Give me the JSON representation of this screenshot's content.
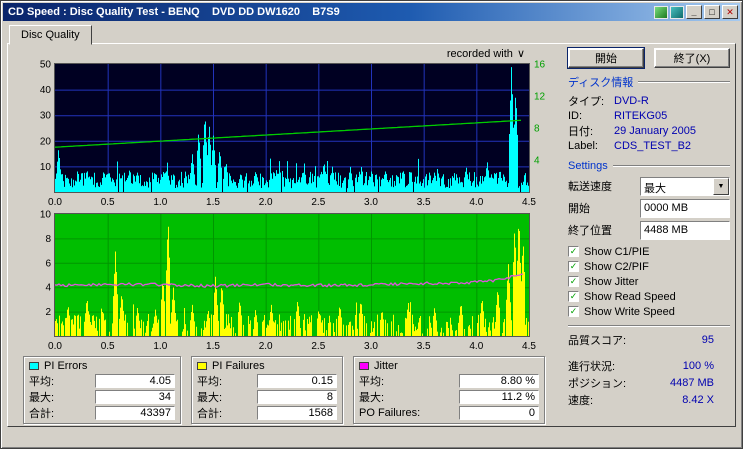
{
  "window": {
    "title": "CD Speed : Disc Quality Test - BENQ    DVD DD DW1620    B7S9"
  },
  "icons": {
    "minimize": "_",
    "maximize": "□",
    "close": "✕",
    "check": "✓",
    "dropdown_arrow": "▼",
    "recorded_arrow": "∨"
  },
  "tab": {
    "label": "Disc Quality"
  },
  "chart_header": {
    "recorded_with": "recorded with"
  },
  "actions": {
    "start": "開始",
    "exit": "終了(X)"
  },
  "disc_info": {
    "header": "ディスク情報",
    "rows": [
      {
        "label": "タイプ:",
        "value": "DVD-R"
      },
      {
        "label": "ID:",
        "value": "RITEKG05"
      },
      {
        "label": "日付:",
        "value": "29 January 2005"
      },
      {
        "label": "Label:",
        "value": "CDS_TEST_B2"
      }
    ]
  },
  "settings": {
    "header": "Settings",
    "speed": {
      "label": "転送速度",
      "value": "最大"
    },
    "start": {
      "label": "開始",
      "value": "0000 MB"
    },
    "end": {
      "label": "終了位置",
      "value": "4488 MB"
    },
    "checkboxes": [
      {
        "label": "Show C1/PIE",
        "checked": true
      },
      {
        "label": "Show C2/PIF",
        "checked": true
      },
      {
        "label": "Show Jitter",
        "checked": true
      },
      {
        "label": "Show Read Speed",
        "checked": true
      },
      {
        "label": "Show Write Speed",
        "checked": true
      }
    ]
  },
  "status": {
    "quality": {
      "label": "品質スコア:",
      "value": "95"
    },
    "progress": {
      "label": "進行状況:",
      "value": "100 %"
    },
    "position": {
      "label": "ポジション:",
      "value": "4487 MB"
    },
    "speed": {
      "label": "速度:",
      "value": "8.42 X"
    }
  },
  "stats": {
    "pi_errors": {
      "title": "PI Errors",
      "color": "#00FFFF",
      "rows": [
        {
          "label": "平均:",
          "value": "4.05"
        },
        {
          "label": "最大:",
          "value": "34"
        },
        {
          "label": "合計:",
          "value": "43397"
        }
      ]
    },
    "pi_failures": {
      "title": "PI Failures",
      "color": "#FFFF00",
      "rows": [
        {
          "label": "平均:",
          "value": "0.15"
        },
        {
          "label": "最大:",
          "value": "8"
        },
        {
          "label": "合計:",
          "value": "1568"
        }
      ]
    },
    "jitter": {
      "title": "Jitter",
      "color": "#FF00FF",
      "rows": [
        {
          "label": "平均:",
          "value": "8.80 %"
        },
        {
          "label": "最大:",
          "value": "11.2 %"
        },
        {
          "label": "PO Failures:",
          "value": "0"
        }
      ]
    }
  },
  "chart_data": [
    {
      "type": "area",
      "name": "pi-errors-and-speed",
      "x_range": [
        0,
        4.5
      ],
      "x_ticks": [
        "0.0",
        "0.5",
        "1.0",
        "1.5",
        "2.0",
        "2.5",
        "3.0",
        "3.5",
        "4.0",
        "4.5"
      ],
      "y_left": {
        "max": 50,
        "ticks": [
          10,
          20,
          30,
          40,
          50
        ]
      },
      "y_right": {
        "max": 16,
        "ticks": [
          4,
          8,
          12,
          16
        ]
      },
      "bg": "#000022",
      "grid": "#2233bb",
      "series_color": "#00FFFF",
      "seed": 1337,
      "density": 0.97,
      "noise": [
        1.5,
        8
      ],
      "spikes": [
        [
          0.03,
          17
        ],
        [
          0.3,
          9
        ],
        [
          0.7,
          8
        ],
        [
          1.05,
          9
        ],
        [
          1.3,
          15
        ],
        [
          1.36,
          24
        ],
        [
          1.42,
          31
        ],
        [
          1.46,
          27
        ],
        [
          1.5,
          22
        ],
        [
          1.56,
          17
        ],
        [
          1.62,
          12
        ],
        [
          1.9,
          8
        ],
        [
          2.1,
          9
        ],
        [
          2.55,
          12
        ],
        [
          2.63,
          10
        ],
        [
          2.8,
          10
        ],
        [
          3.0,
          8
        ],
        [
          3.3,
          9
        ],
        [
          3.6,
          8
        ],
        [
          3.9,
          10
        ],
        [
          4.1,
          12
        ],
        [
          4.22,
          9
        ],
        [
          4.33,
          50
        ],
        [
          4.37,
          40
        ]
      ],
      "overlay_line": {
        "color": "#00CC00",
        "noise": 0,
        "points": [
          [
            0,
            17.5
          ],
          [
            4.42,
            28
          ]
        ]
      }
    },
    {
      "type": "bar",
      "name": "pi-failures-and-jitter",
      "x_range": [
        0,
        4.5
      ],
      "x_ticks": [
        "0.0",
        "0.5",
        "1.0",
        "1.5",
        "2.0",
        "2.5",
        "3.0",
        "3.5",
        "4.0",
        "4.5"
      ],
      "y_left": {
        "max": 10,
        "ticks": [
          2,
          4,
          6,
          8,
          10
        ]
      },
      "bg": "#00BE00",
      "grid": "#009600",
      "series_color": "#FFFF00",
      "seed": 4242,
      "density": 0.62,
      "noise": [
        0.2,
        1.8
      ],
      "spikes": [
        [
          0.12,
          2.6
        ],
        [
          0.3,
          3.2
        ],
        [
          0.45,
          2.2
        ],
        [
          0.57,
          7
        ],
        [
          0.63,
          3.6
        ],
        [
          0.78,
          2.4
        ],
        [
          0.95,
          2.2
        ],
        [
          1.02,
          4.8
        ],
        [
          1.07,
          9.7
        ],
        [
          1.12,
          4
        ],
        [
          1.3,
          2.6
        ],
        [
          1.45,
          2.2
        ],
        [
          1.52,
          5
        ],
        [
          1.58,
          4.4
        ],
        [
          1.75,
          3
        ],
        [
          1.9,
          2.2
        ],
        [
          2.05,
          2.6
        ],
        [
          2.3,
          3
        ],
        [
          2.5,
          2.2
        ],
        [
          2.7,
          2.6
        ],
        [
          2.9,
          3
        ],
        [
          3.1,
          2.2
        ],
        [
          3.35,
          2.8
        ],
        [
          3.6,
          2.4
        ],
        [
          3.85,
          2.8
        ],
        [
          4.05,
          3.2
        ],
        [
          4.2,
          4
        ],
        [
          4.3,
          6
        ],
        [
          4.36,
          9
        ],
        [
          4.4,
          10
        ],
        [
          4.44,
          8
        ]
      ],
      "overlay_line": {
        "color": "#DD55DD",
        "noise": 0.12,
        "points": [
          [
            0,
            4.15
          ],
          [
            0.5,
            4.25
          ],
          [
            1,
            4.2
          ],
          [
            1.5,
            4.1
          ],
          [
            2,
            4.2
          ],
          [
            2.5,
            4.15
          ],
          [
            3,
            4.2
          ],
          [
            3.5,
            4.3
          ],
          [
            3.9,
            4.35
          ],
          [
            4.15,
            4.5
          ],
          [
            4.35,
            4.85
          ],
          [
            4.45,
            5.05
          ]
        ]
      }
    }
  ]
}
